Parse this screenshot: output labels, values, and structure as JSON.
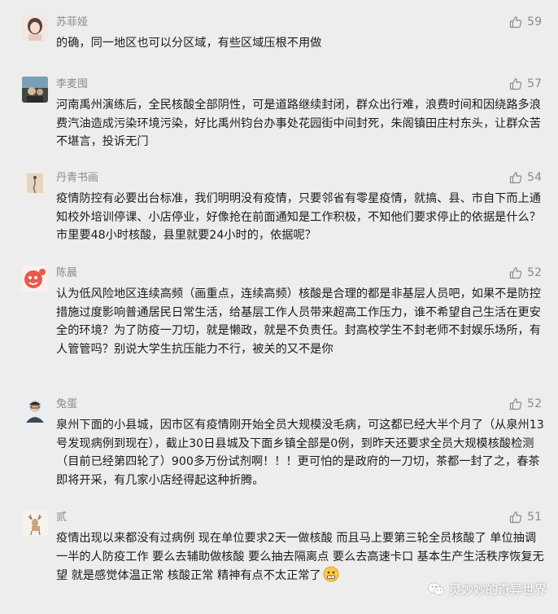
{
  "comments": [
    {
      "user": "苏菲娅",
      "likes": "59",
      "text": "的确，同一地区也可以分区域，有些区域压根不用做"
    },
    {
      "user": "李麦囤",
      "likes": "57",
      "text": "河南禹州演练后，全民核酸全部阴性，可是道路继续封闭，群众出行难，浪费时间和因绕路多浪费汽油造成污染环境污染，好比禹州钧台办事处花园街中间封死，朱阁镇田庄村东头，让群众苦不堪言，投诉无门"
    },
    {
      "user": "丹青书画",
      "likes": "54",
      "text": "疫情防控有必要出台标准，我们明明没有疫情，只要邻省有零星疫情，就搞、县、市自下而上通知校外培训停课、小店停业，好像抢在前面通知是工作积极，不知他们要求停止的依据是什么？市里要48小时核酸，县里就要24小时的，依据呢？"
    },
    {
      "user": "陈晨",
      "likes": "52",
      "text": "认为低风险地区连续高频（画重点，连续高频）核酸是合理的都是非基层人员吧，如果不是防控措施过度影响普通居民日常生活，给基层工作人员带来超高工作压力，谁不希望自己生活在更安全的环境？为了防疫一刀切，就是懒政，就是不负责任。封高校学生不封老师不封娱乐场所，有人管管吗？别说大学生抗压能力不行，被关的又不是你"
    },
    {
      "user": "兔蛋",
      "likes": "52",
      "text": "泉州下面的小县城，因市区有疫情刚开始全员大规模没毛病，可这都已经大半个月了（从泉州13号发现病例到现在），截止30日县城及下面乡镇全部是0例，到昨天还要求全员大规模核酸检测（目前已经第四轮了）900多万份试剂啊！！！更可怕的是政府的一刀切，茶都一封了之，春茶即将开采，有几家小店经得起这种折腾。"
    },
    {
      "user": "贰",
      "likes": "51",
      "text": "疫情出现以来都没有过病例 现在单位要求2天一做核酸 而且马上要第三轮全员核酸了 单位抽调一半的人防疫工作 要么去辅助做核酸 要么抽去隔离点 要么去高速卡口 基本生产生活秩序恢复无望 就是感觉体温正常 核酸正常 精神有点不太正常了"
    }
  ],
  "watermark": "灵妙妙的奇异世界",
  "icons": {
    "like": "thumbs-up-icon",
    "emoji": "grimace-emoji-icon",
    "watermark": "wechat-logo-icon"
  },
  "colors": {
    "background": "#ededed",
    "meta_text": "#8a8a8a",
    "body_text": "#1c1c1c"
  }
}
